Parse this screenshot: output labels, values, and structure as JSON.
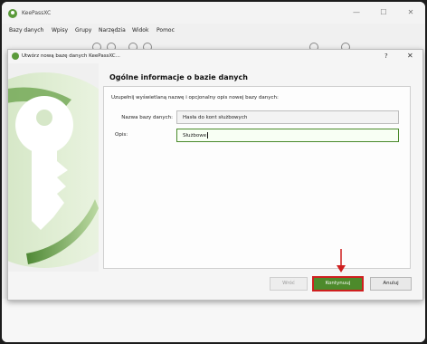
{
  "app": {
    "title": "KeePassXC",
    "window_controls": {
      "minimize": "—",
      "maximize": "☐",
      "close": "✕"
    }
  },
  "menubar": [
    "Bazy danych",
    "Wpisy",
    "Grupy",
    "Narzędzia",
    "Widok",
    "Pomoc"
  ],
  "dialog": {
    "title": "Utwórz nową bazę danych KeePassXC...",
    "help": "?",
    "close": "✕",
    "heading": "Ogólne informacje o bazie danych",
    "description": "Uzupełnij wyświetlaną nazwę i opcjonalny opis nowej bazy danych:",
    "fields": {
      "name_label": "Nazwa bazy danych:",
      "name_value": "Hasła do kont służbowych",
      "desc_label": "Opis:",
      "desc_value": "Służbowe"
    },
    "buttons": {
      "back": "Wróć",
      "continue": "Kontynuuj",
      "cancel": "Anuluj"
    }
  },
  "colors": {
    "accent_green": "#4d8a2b",
    "highlight_red": "#cf1f1f"
  },
  "icons": [
    "keepassxc-logo-icon",
    "key-logo-icon",
    "red-arrow-icon"
  ]
}
